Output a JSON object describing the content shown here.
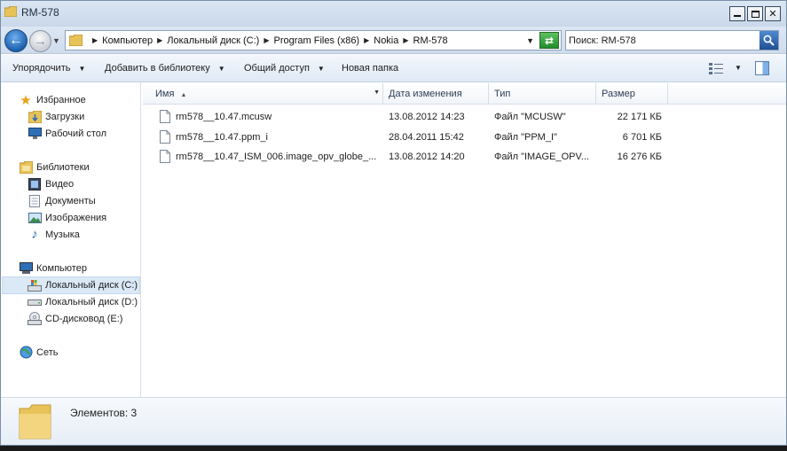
{
  "window": {
    "title": "RM-578"
  },
  "nav_buttons": {
    "back": "back",
    "forward": "forward"
  },
  "address": {
    "crumbs": [
      "Компьютер",
      "Локальный диск (C:)",
      "Program Files (x86)",
      "Nokia",
      "RM-578"
    ]
  },
  "search": {
    "value": "Поиск: RM-578"
  },
  "toolbar": {
    "organize": "Упорядочить",
    "add_to_library": "Добавить в библиотеку",
    "share": "Общий доступ",
    "new_folder": "Новая папка"
  },
  "sidebar": {
    "favorites": "Избранное",
    "downloads": "Загрузки",
    "desktop": "Рабочий стол",
    "libraries": "Библиотеки",
    "video": "Видео",
    "documents": "Документы",
    "images": "Изображения",
    "music": "Музыка",
    "computer": "Компьютер",
    "disk_c": "Локальный диск (C:)",
    "disk_d": "Локальный диск (D:)",
    "cd_e": "CD-дисковод (E:)",
    "network": "Сеть"
  },
  "columns": {
    "name": "Имя",
    "date": "Дата изменения",
    "type": "Тип",
    "size": "Размер"
  },
  "files": [
    {
      "name": "rm578__10.47.mcusw",
      "date": "13.08.2012 14:23",
      "type": "Файл \"MCUSW\"",
      "size": "22 171 КБ"
    },
    {
      "name": "rm578__10.47.ppm_i",
      "date": "28.04.2011 15:42",
      "type": "Файл \"PPM_I\"",
      "size": "6 701 КБ"
    },
    {
      "name": "rm578__10.47_ISM_006.image_opv_globe_...",
      "date": "13.08.2012 14:20",
      "type": "Файл \"IMAGE_OPV...",
      "size": "16 276 КБ"
    }
  ],
  "details": {
    "count_label": "Элементов: 3"
  },
  "colors": {
    "accent": "#1d5fae",
    "selection": "#dbe8f6",
    "folder": "#e8c35a"
  }
}
